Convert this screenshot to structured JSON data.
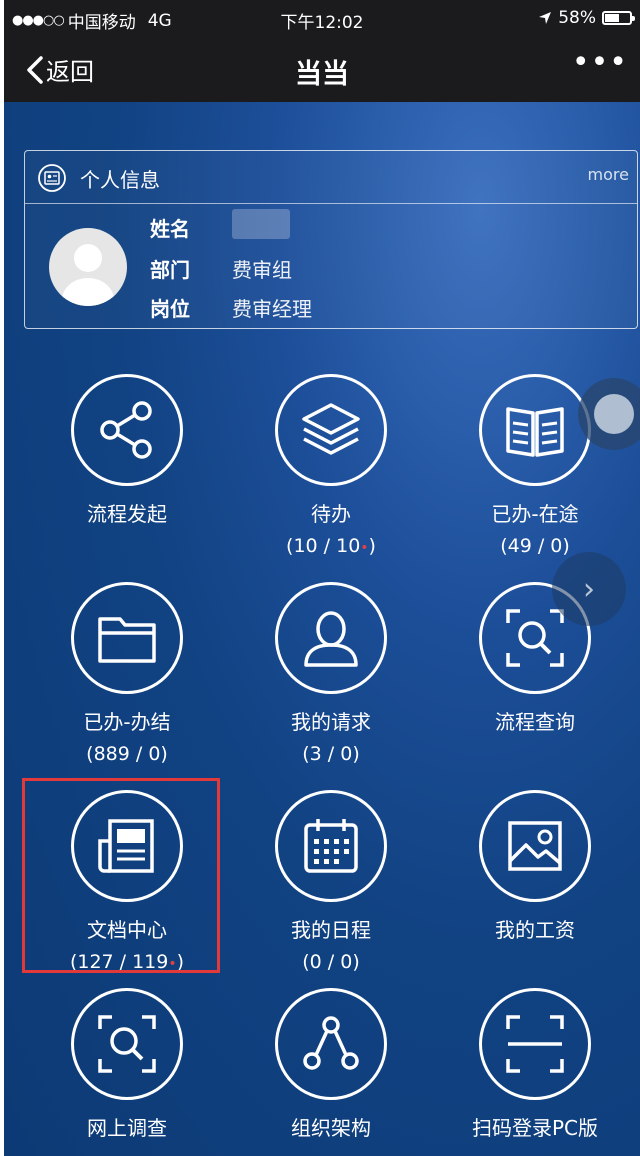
{
  "status_bar": {
    "signal": "●●●○○",
    "carrier": "中国移动",
    "network": "4G",
    "time": "下午12:02",
    "battery_percent": "58%",
    "battery_level": 0.58
  },
  "nav": {
    "back_label": "返回",
    "title": "当当",
    "more_label": "•••"
  },
  "profile": {
    "header": "个人信息",
    "more": "more",
    "rows": [
      {
        "key": "姓名",
        "value": ""
      },
      {
        "key": "部门",
        "value": "费审组"
      },
      {
        "key": "岗位",
        "value": "费审经理"
      }
    ]
  },
  "grid": [
    {
      "label": "流程发起",
      "count": "",
      "icon": "share-icon"
    },
    {
      "label": "待办",
      "count": "(10 / 10",
      "icon": "layers-icon",
      "dot": true
    },
    {
      "label": "已办-在途",
      "count": "(49 / 0)",
      "icon": "book-icon"
    },
    {
      "label": "已办-办结",
      "count": "(889 / 0)",
      "icon": "folder-icon"
    },
    {
      "label": "我的请求",
      "count": "(3 / 0)",
      "icon": "user-icon"
    },
    {
      "label": "流程查询",
      "count": "",
      "icon": "scan-search-icon"
    },
    {
      "label": "文档中心",
      "count": "(127 / 119",
      "icon": "newspaper-icon",
      "dot": true
    },
    {
      "label": "我的日程",
      "count": "(0 / 0)",
      "icon": "calendar-icon"
    },
    {
      "label": "我的工资",
      "count": "",
      "icon": "picture-icon"
    },
    {
      "label": "网上调查",
      "count": "",
      "icon": "scan-search-icon"
    },
    {
      "label": "组织架构",
      "count": "",
      "icon": "org-chart-icon"
    },
    {
      "label": "扫码登录PC版",
      "count": "",
      "icon": "qr-scan-icon"
    }
  ],
  "dot_char": "•",
  "close_paren": ")",
  "side_arrow": "›",
  "colors": {
    "bar_bg": "#1b1b1d",
    "content_blue": "#114282",
    "highlight_red": "#e23a3a"
  }
}
